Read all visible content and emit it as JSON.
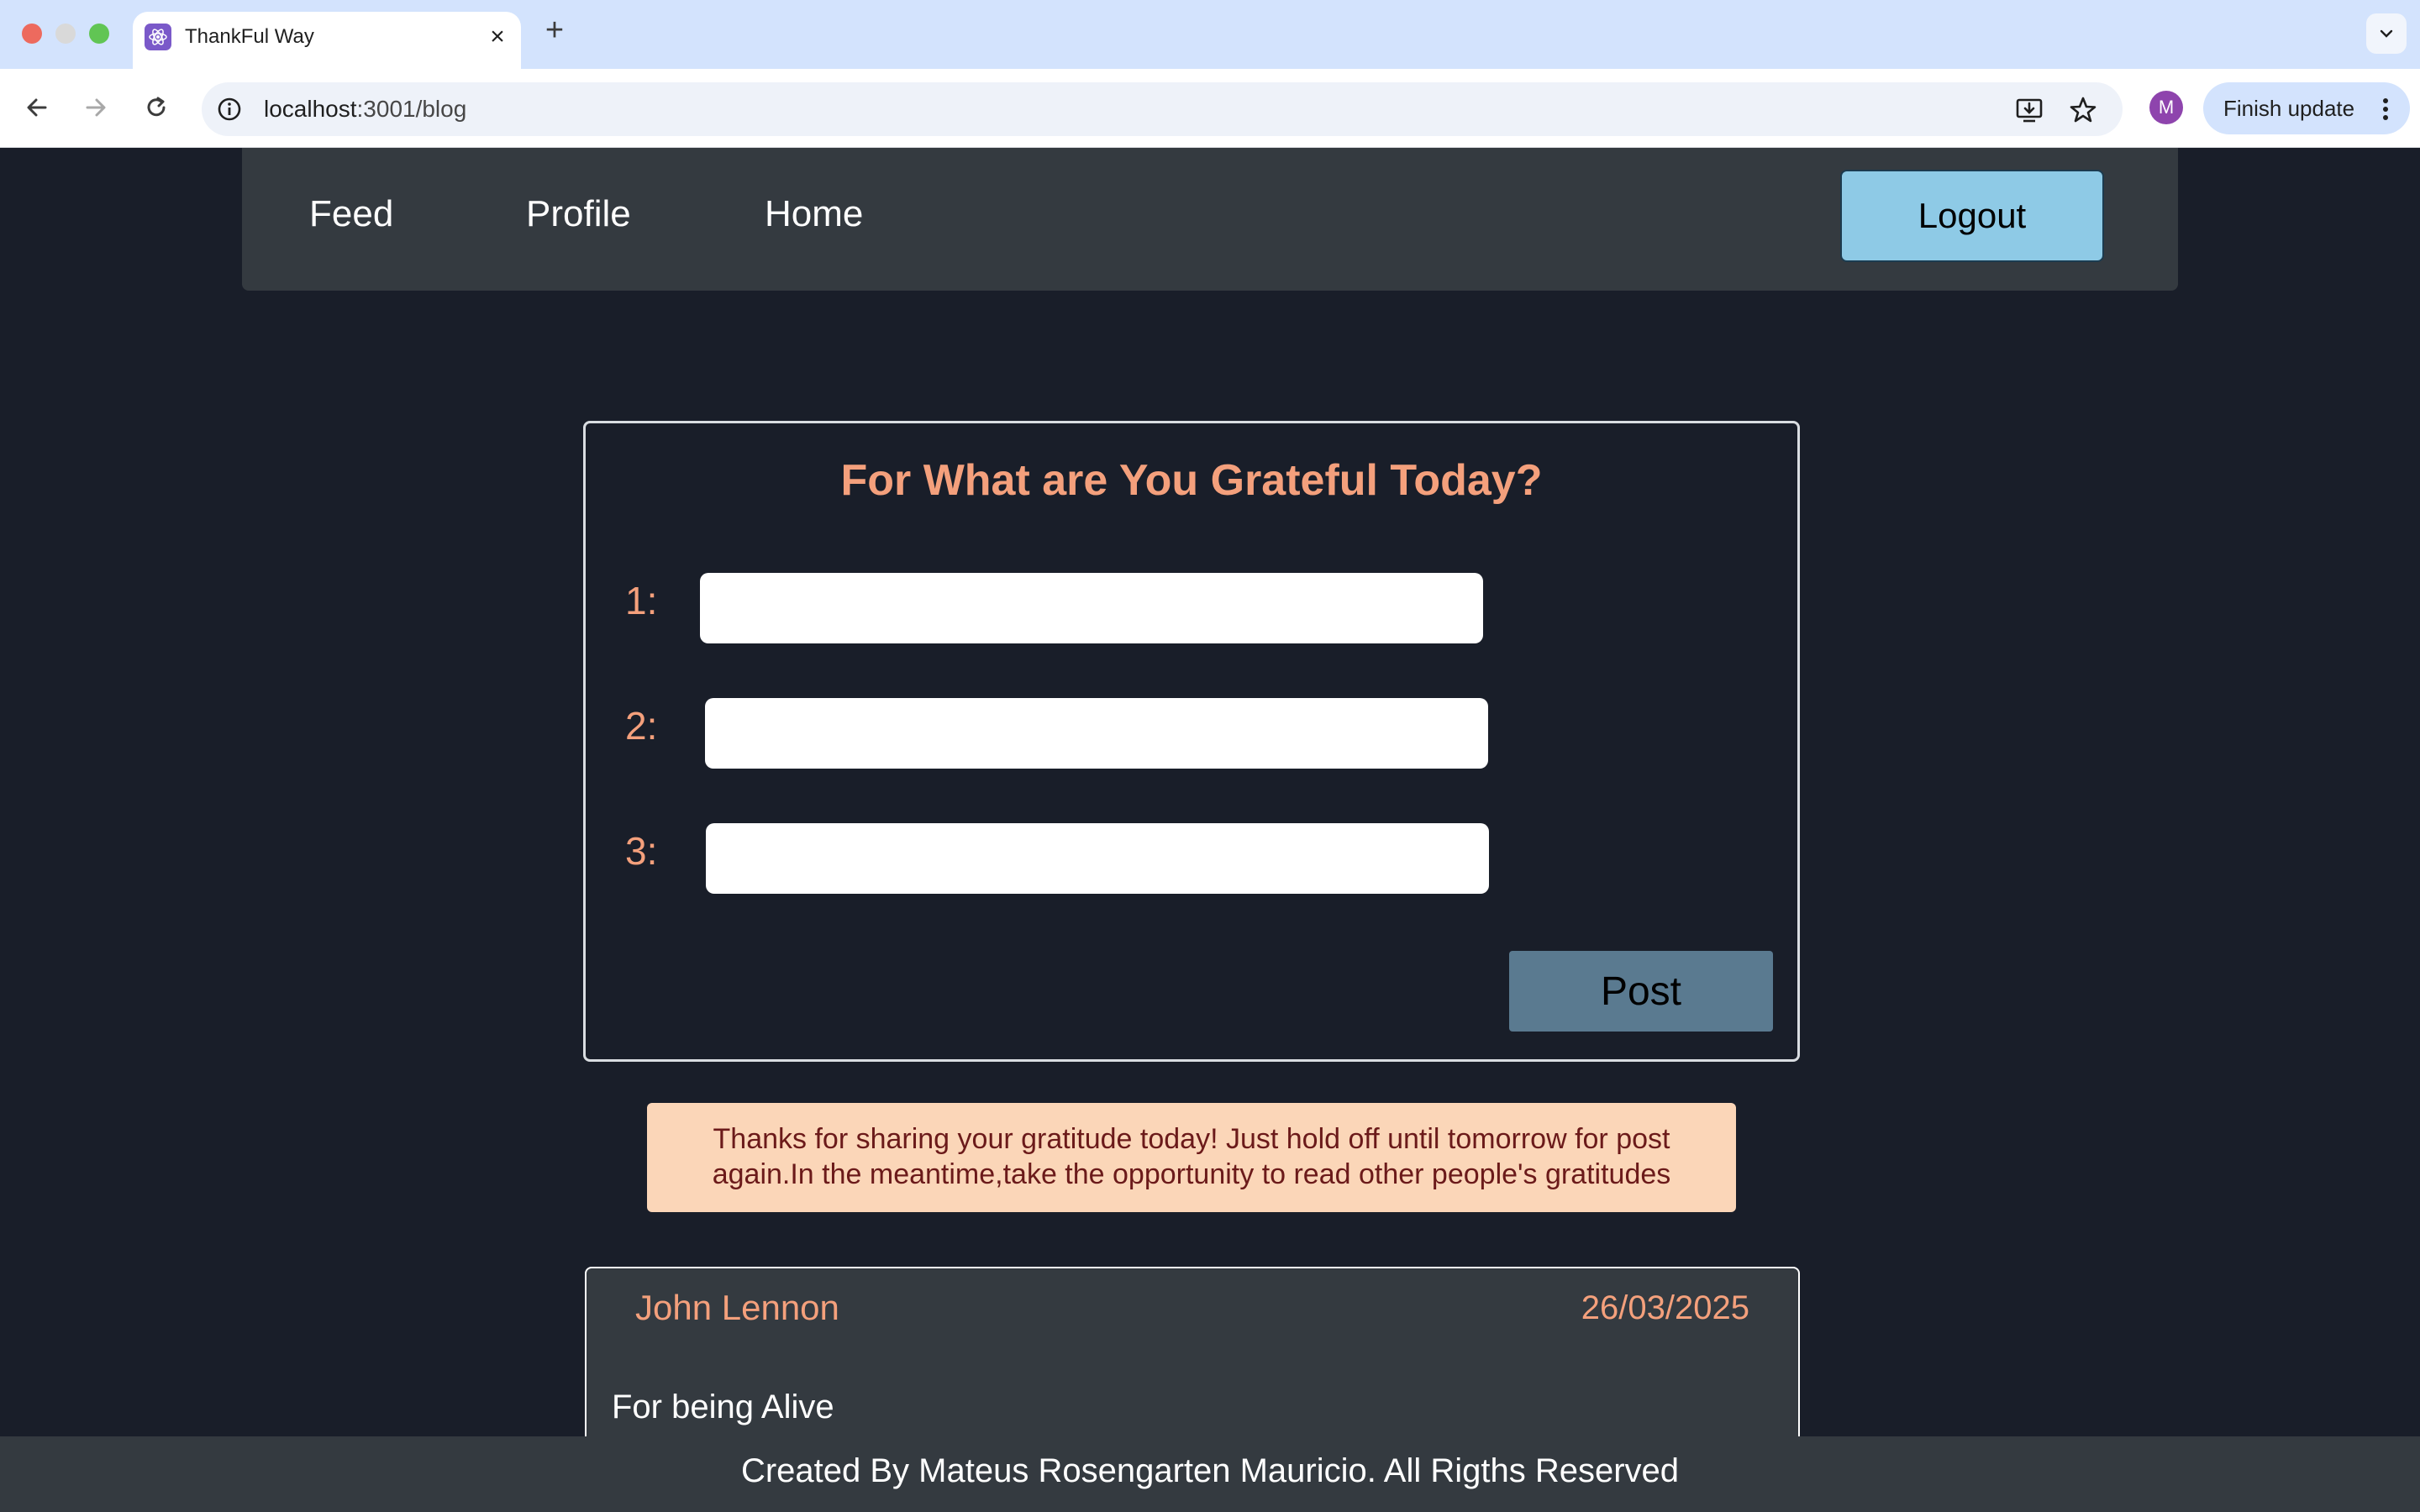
{
  "browser": {
    "tab_title": "ThankFul Way",
    "url_host": "localhost",
    "url_rest": ":3001/blog",
    "profile_initial": "M",
    "update_label": "Finish update"
  },
  "navbar": {
    "links": [
      "Feed",
      "Profile",
      "Home"
    ],
    "logout_label": "Logout"
  },
  "gratitude_form": {
    "title": "For What are You Grateful Today?",
    "fields": [
      {
        "label": "1:",
        "value": ""
      },
      {
        "label": "2:",
        "value": ""
      },
      {
        "label": "3:",
        "value": ""
      }
    ],
    "post_label": "Post"
  },
  "notice": {
    "line1": "Thanks for sharing your gratitude today! Just hold off until tomorrow for post",
    "line2": "again.In the meantime,take the opportunity to read other people's gratitudes"
  },
  "feed": [
    {
      "author": "John Lennon",
      "date": "26/03/2025",
      "text": "For being Alive"
    }
  ],
  "footer": {
    "text": "Created By Mateus Rosengarten Mauricio. All Rigths Reserved"
  },
  "colors": {
    "page_bg": "#191e29",
    "navbar_bg": "#343a40",
    "accent_orange": "#f4a07c",
    "logout_bg": "#8ecae6",
    "post_bg": "#5a7a90",
    "notice_bg": "#fbd6b8",
    "notice_text": "#6b1a1a"
  },
  "icons": [
    "react-favicon-icon",
    "close-icon",
    "plus-icon",
    "chevron-down-icon",
    "back-arrow-icon",
    "forward-arrow-icon",
    "reload-icon",
    "site-info-icon",
    "install-app-icon",
    "bookmark-star-icon",
    "kebab-menu-icon"
  ]
}
